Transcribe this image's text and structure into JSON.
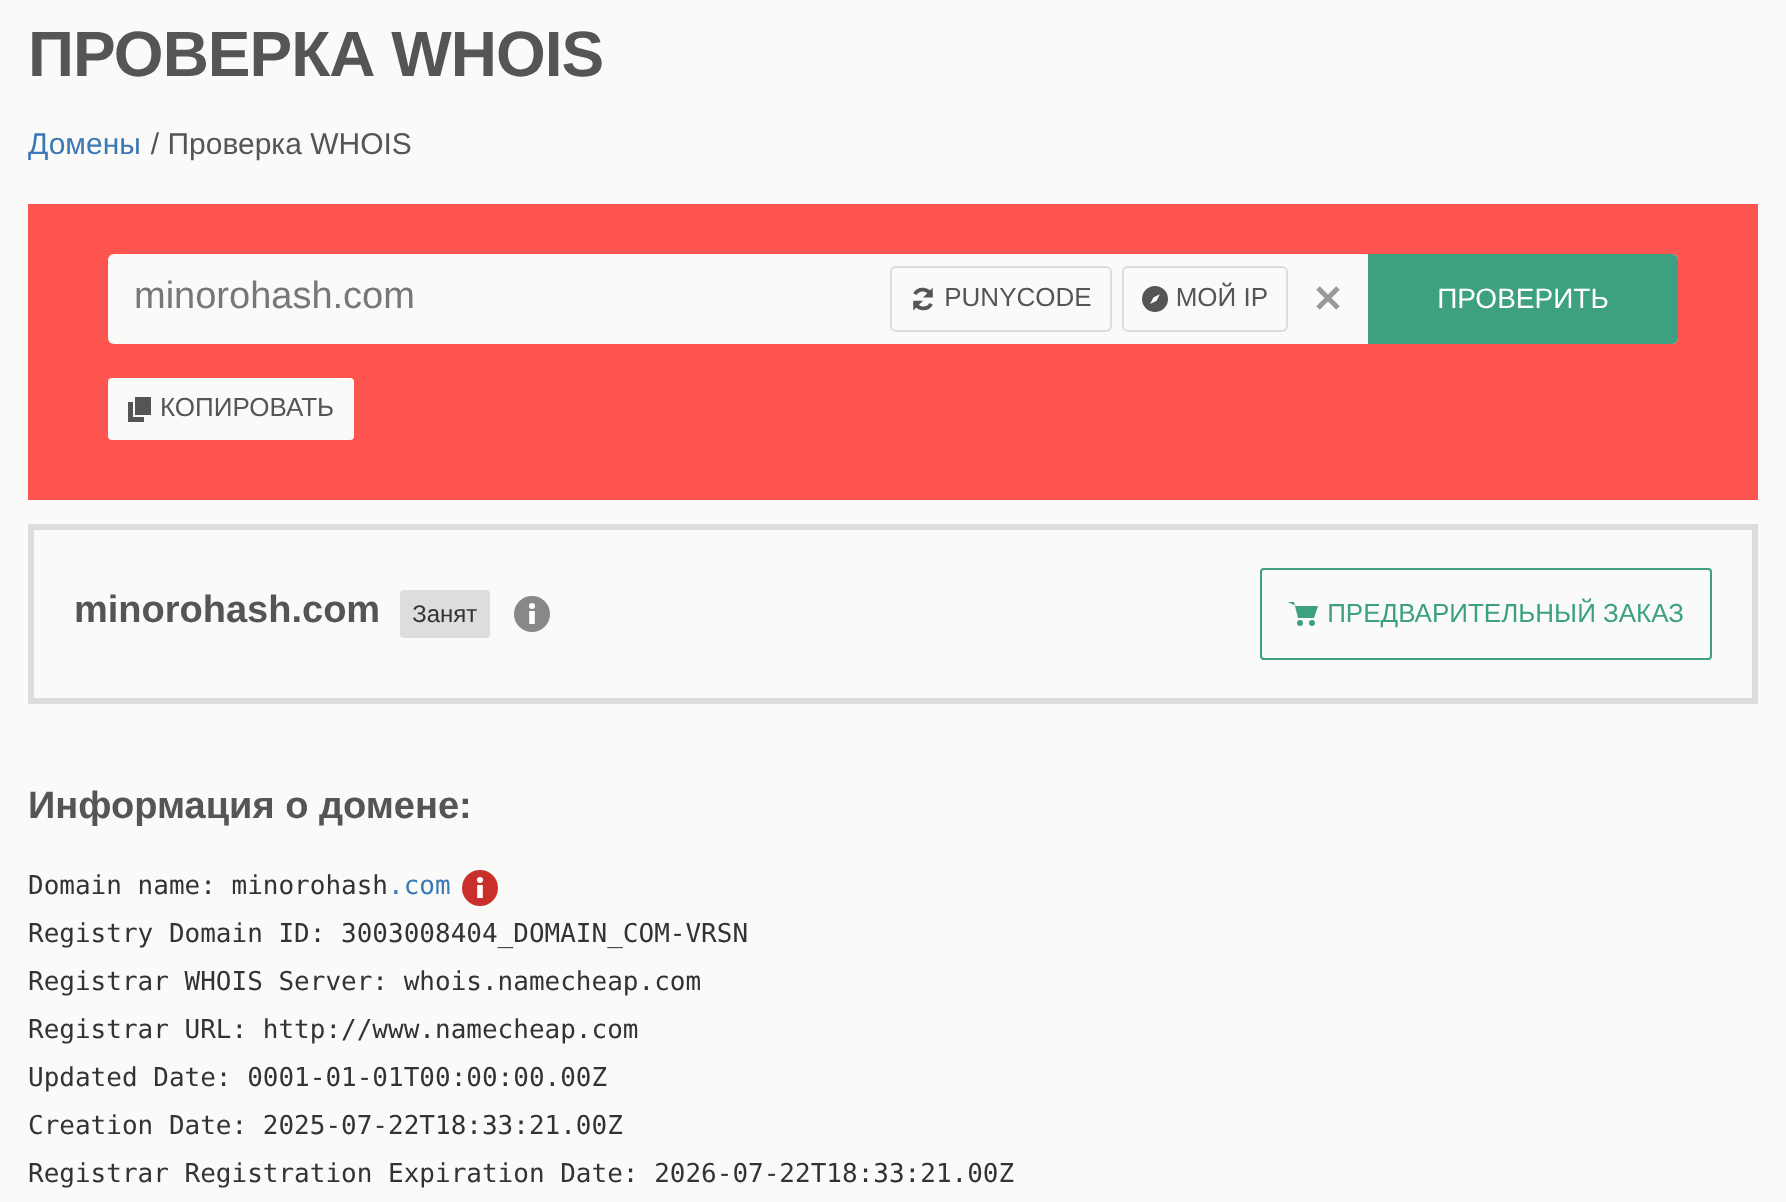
{
  "title": "ПРОВЕРКА WHOIS",
  "breadcrumb": [
    {
      "label": "Домены",
      "link": true
    },
    {
      "label": "/ Проверка WHOIS",
      "link": false
    }
  ],
  "search": {
    "value": "minorohash.com",
    "buttons": [
      {
        "kind": "punycode",
        "label": "PUNYCODE"
      },
      {
        "kind": "myip",
        "label": "МОЙ IP"
      }
    ],
    "submit": "ПРОВЕРИТЬ",
    "copy": "КОПИРОВАТЬ"
  },
  "result": {
    "domain": "minorohash.com",
    "status": "Занят",
    "action": "ПРЕДВАРИТЕЛЬНЫЙ ЗАКАЗ"
  },
  "info": {
    "heading": "Информация о домене:",
    "lines": [
      {
        "text": "Domain name: minorohash",
        "link": ".com",
        "warning": true
      },
      {
        "text": "Registry Domain ID: 3003008404_DOMAIN_COM-VRSN"
      },
      {
        "text": "Registrar WHOIS Server: whois.namecheap.com"
      },
      {
        "text": "Registrar URL: http://www.namecheap.com"
      },
      {
        "text": "Updated Date: 0001-01-01T00:00:00.00Z"
      },
      {
        "text": "Creation Date: 2025-07-22T18:33:21.00Z"
      },
      {
        "text": "Registrar Registration Expiration Date: 2026-07-22T18:33:21.00Z"
      }
    ]
  }
}
